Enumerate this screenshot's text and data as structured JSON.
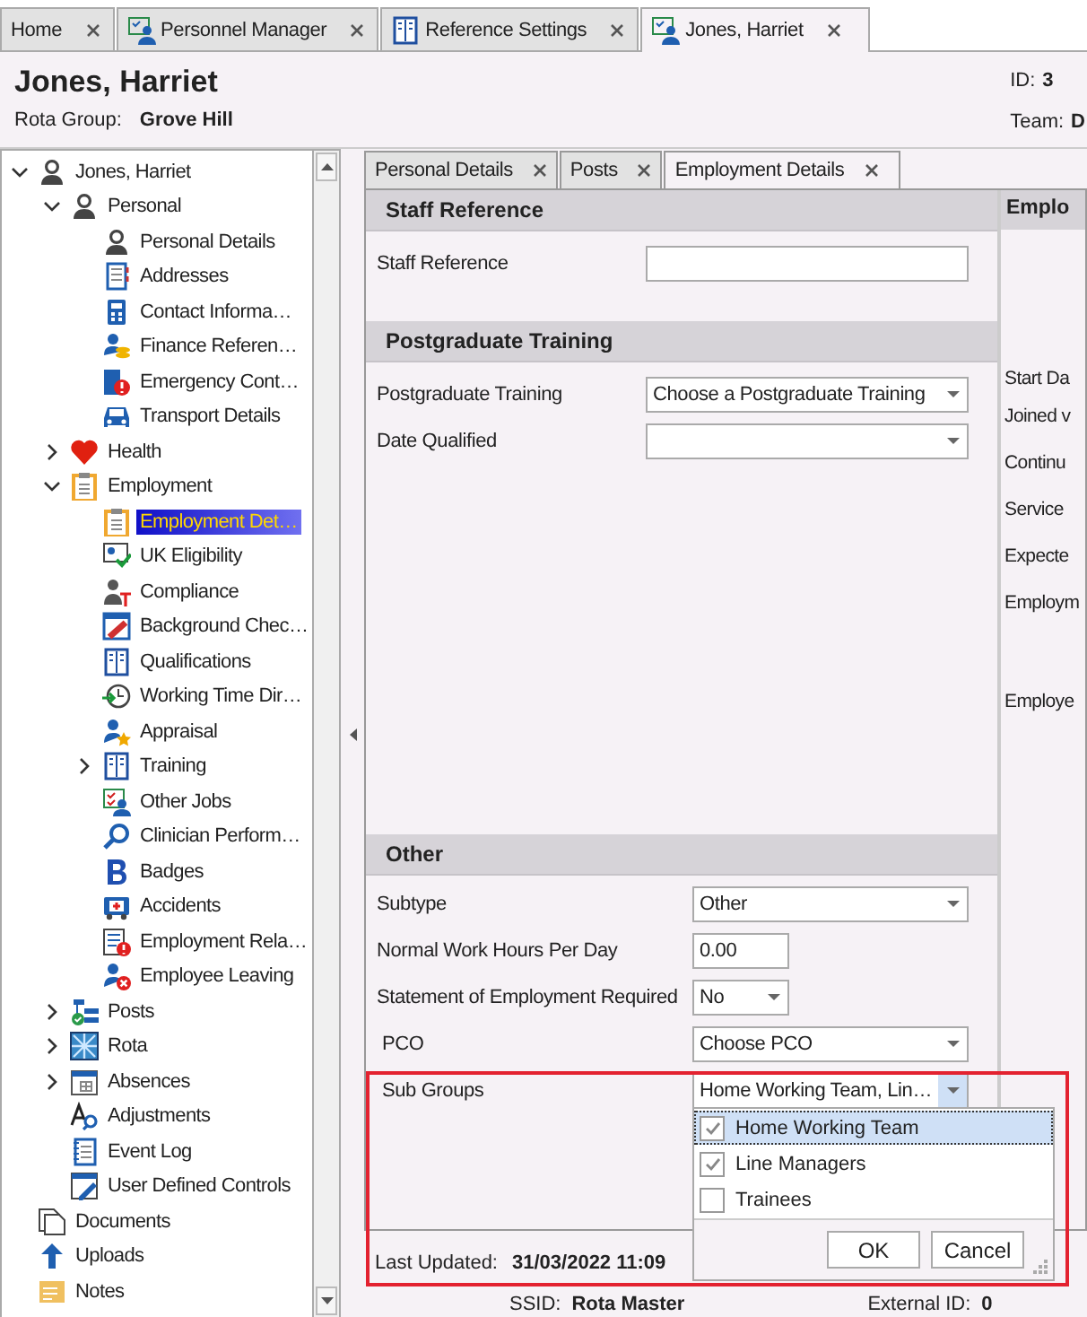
{
  "document_tabs": [
    {
      "label": "Home",
      "selected": false
    },
    {
      "label": "Personnel Manager",
      "selected": false
    },
    {
      "label": "Reference Settings",
      "selected": false
    },
    {
      "label": "Jones, Harriet",
      "selected": true
    }
  ],
  "header": {
    "name": "Jones, Harriet",
    "rota_group_label": "Rota Group:",
    "rota_group": "Grove Hill",
    "id_label": "ID:",
    "id_value": "3",
    "team_label": "Team:",
    "team_value": "D"
  },
  "tree": [
    {
      "label": "Jones, Harriet",
      "selected": false,
      "expanded": true,
      "children": [
        {
          "label": "Personal",
          "selected": false,
          "expanded": true,
          "children": [
            {
              "label": "Personal Details",
              "selected": false
            },
            {
              "label": "Addresses",
              "selected": false
            },
            {
              "label": "Contact Informa…",
              "selected": false
            },
            {
              "label": "Finance Referen…",
              "selected": false
            },
            {
              "label": "Emergency Cont…",
              "selected": false
            },
            {
              "label": "Transport Details",
              "selected": false
            }
          ]
        },
        {
          "label": "Health",
          "selected": false,
          "expanded": false
        },
        {
          "label": "Employment",
          "selected": false,
          "expanded": true,
          "children": [
            {
              "label": "Employment Det…",
              "selected": true
            },
            {
              "label": "UK Eligibility",
              "selected": false
            },
            {
              "label": "Compliance",
              "selected": false
            },
            {
              "label": "Background Chec…",
              "selected": false
            },
            {
              "label": "Qualifications",
              "selected": false
            },
            {
              "label": "Working Time Dir…",
              "selected": false
            },
            {
              "label": "Appraisal",
              "selected": false
            },
            {
              "label": "Training",
              "selected": false,
              "expanded": false
            },
            {
              "label": "Other Jobs",
              "selected": false
            },
            {
              "label": "Clinician Perform…",
              "selected": false
            },
            {
              "label": "Badges",
              "selected": false
            },
            {
              "label": "Accidents",
              "selected": false
            },
            {
              "label": "Employment Rela…",
              "selected": false
            },
            {
              "label": "Employee Leaving",
              "selected": false
            }
          ]
        },
        {
          "label": "Posts",
          "selected": false,
          "expanded": false
        },
        {
          "label": "Rota",
          "selected": false,
          "expanded": false
        },
        {
          "label": "Absences",
          "selected": false,
          "expanded": false
        },
        {
          "label": "Adjustments",
          "selected": false
        },
        {
          "label": "Event Log",
          "selected": false
        },
        {
          "label": "User Defined Controls",
          "selected": false
        }
      ]
    },
    {
      "label": "Documents",
      "selected": false
    },
    {
      "label": "Uploads",
      "selected": false
    },
    {
      "label": "Notes",
      "selected": false
    }
  ],
  "panel_tabs": [
    {
      "label": "Personal Details",
      "selected": false
    },
    {
      "label": "Posts",
      "selected": false
    },
    {
      "label": "Employment Details",
      "selected": true
    }
  ],
  "sections": [
    {
      "title": "Staff Reference",
      "fields": [
        {
          "label": "Staff Reference",
          "kind": "text"
        }
      ]
    },
    {
      "title": "Postgraduate Training",
      "fields": [
        {
          "label": "Postgraduate Training",
          "kind": "combo",
          "value": "Choose a Postgraduate Training"
        },
        {
          "label": "Date Qualified",
          "kind": "combo"
        }
      ]
    },
    {
      "title": "Other",
      "fields": [
        {
          "label": "Subtype",
          "kind": "combo",
          "value": "Other"
        },
        {
          "label": "Normal Work Hours Per Day",
          "kind": "text",
          "value": "0.00"
        },
        {
          "label": "Statement of Employment Required",
          "kind": "combo",
          "value": "No"
        },
        {
          "label": "PCO",
          "kind": "combo",
          "value": "Choose PCO"
        },
        {
          "label": "Sub Groups",
          "kind": "combo",
          "value": "Home Working Team, Lin…",
          "open": true
        }
      ]
    }
  ],
  "sub_groups_popup": {
    "options": [
      {
        "label": "Home Working Team",
        "checked": true,
        "selected": true
      },
      {
        "label": "Line Managers",
        "checked": true,
        "selected": false
      },
      {
        "label": "Trainees",
        "checked": false,
        "selected": false
      }
    ],
    "buttons": [
      "OK",
      "Cancel"
    ]
  },
  "right_column": {
    "title": "Emplo",
    "labels": [
      "Start Da",
      "Joined v",
      "Continu",
      "Service",
      "Expecte",
      "Employm",
      "Employe"
    ]
  },
  "footer": {
    "last_updated_label": "Last Updated:",
    "last_updated": "31/03/2022 11:09",
    "ssid_label": "SSID:",
    "ssid": "Rota Master",
    "external_id_label": "External ID:",
    "external_id": "0"
  }
}
